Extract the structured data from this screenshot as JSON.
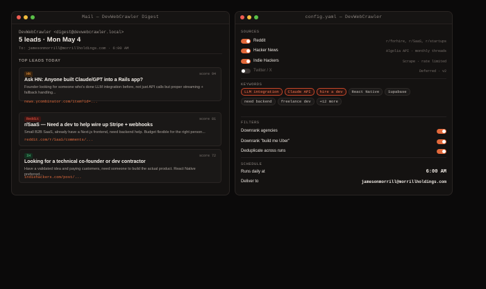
{
  "mail": {
    "window_title": "Mail — DevWebCrawler Digest",
    "from": "DevWebCrawler <digest@devwebcrawler.local>",
    "subject": "5 leads · Mon May 4",
    "to": "To: jamesonmorrill@morrillholdings.com · 6:00 AM",
    "section": "TOP LEADS TODAY",
    "leads": [
      {
        "badge": "HN",
        "score": "score 94",
        "title": "Ask HN: Anyone built Claude/GPT into a Rails app?",
        "desc": "Founder looking for someone who's done LLM integration before, not just API calls but proper streaming + fallback handling...",
        "link": "news.ycombinator.com/item?id=..."
      },
      {
        "badge": "Reddit",
        "score": "score 81",
        "title": "r/SaaS — Need a dev to help wire up Stripe + webhooks",
        "desc": "Small B2B SaaS, already have a Next.js frontend, need backend help. Budget flexible for the right person...",
        "link": "reddit.com/r/SaaS/comments/..."
      },
      {
        "badge": "IH",
        "score": "score 72",
        "title": "Looking for a technical co-founder or dev contractor",
        "desc": "Have a validated idea and paying customers, need someone to build the actual product. React Native preferred...",
        "link": "indiehackers.com/post/..."
      }
    ]
  },
  "config": {
    "window_title": "config.yaml — DevWebCrawler",
    "sources_heading": "SOURCES",
    "sources": [
      {
        "label": "Reddit",
        "note": "r/forhire, r/SaaS, r/startups",
        "enabled": true
      },
      {
        "label": "Hacker News",
        "note": "Algolia API · monthly threads",
        "enabled": true
      },
      {
        "label": "Indie Hackers",
        "note": "Scrape · rate limited",
        "enabled": true
      },
      {
        "label": "Twitter / X",
        "note": "Deferred · v2",
        "enabled": false
      }
    ],
    "keywords_heading": "KEYWORDS",
    "keywords": [
      {
        "label": "LLM integration",
        "active": true
      },
      {
        "label": "Claude API",
        "active": true
      },
      {
        "label": "hire a dev",
        "active": true
      },
      {
        "label": "React Native",
        "active": false
      },
      {
        "label": "Supabase",
        "active": false
      },
      {
        "label": "need backend",
        "active": false
      },
      {
        "label": "freelance dev",
        "active": false
      },
      {
        "label": "+12 more",
        "active": false
      }
    ],
    "filters_heading": "FILTERS",
    "filters": [
      {
        "label": "Downrank agencies",
        "enabled": true
      },
      {
        "label": "Downrank \"build me Uber\"",
        "enabled": true
      },
      {
        "label": "Deduplicate across runs",
        "enabled": true
      }
    ],
    "schedule_heading": "SCHEDULE",
    "schedule": {
      "runs_label": "Runs daily at",
      "runs_value": "6:00 AM",
      "deliver_label": "Deliver to",
      "deliver_value": "jamesonmorrill@morrillholdings.com"
    }
  }
}
